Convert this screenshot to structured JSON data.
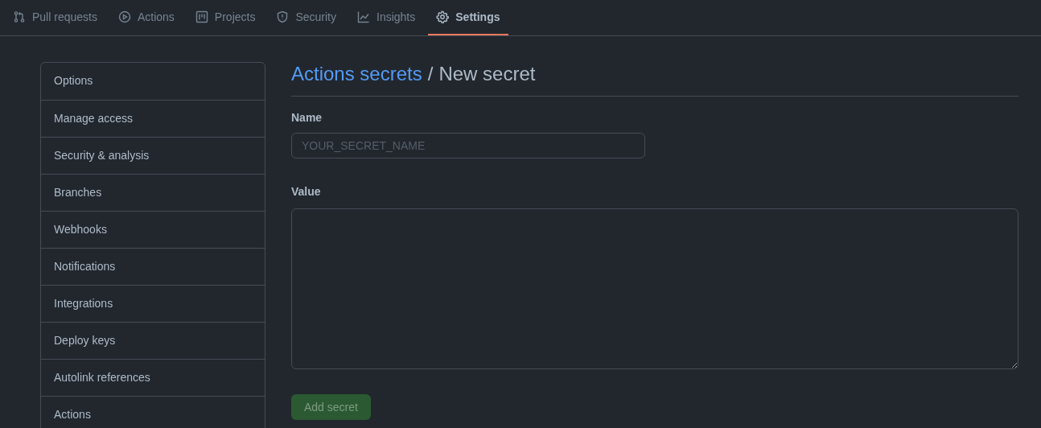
{
  "tabs": [
    {
      "label": "Pull requests",
      "kind": "pull",
      "selected": false
    },
    {
      "label": "Actions",
      "kind": "play",
      "selected": false
    },
    {
      "label": "Projects",
      "kind": "project",
      "selected": false
    },
    {
      "label": "Security",
      "kind": "shield",
      "selected": false
    },
    {
      "label": "Insights",
      "kind": "graph",
      "selected": false
    },
    {
      "label": "Settings",
      "kind": "gear",
      "selected": true
    }
  ],
  "sidebar": {
    "items": [
      {
        "label": "Options",
        "selected": false
      },
      {
        "label": "Manage access",
        "selected": false
      },
      {
        "label": "Security & analysis",
        "selected": false
      },
      {
        "label": "Branches",
        "selected": false
      },
      {
        "label": "Webhooks",
        "selected": false
      },
      {
        "label": "Notifications",
        "selected": false
      },
      {
        "label": "Integrations",
        "selected": false
      },
      {
        "label": "Deploy keys",
        "selected": false
      },
      {
        "label": "Autolink references",
        "selected": false
      },
      {
        "label": "Actions",
        "selected": false
      }
    ]
  },
  "heading": {
    "link": "Actions secrets",
    "separator": "/",
    "title": "New secret"
  },
  "form": {
    "name_label": "Name",
    "name_placeholder": "YOUR_SECRET_NAME",
    "value_label": "Value",
    "submit": {
      "label": "Add secret",
      "disabled": true
    }
  }
}
